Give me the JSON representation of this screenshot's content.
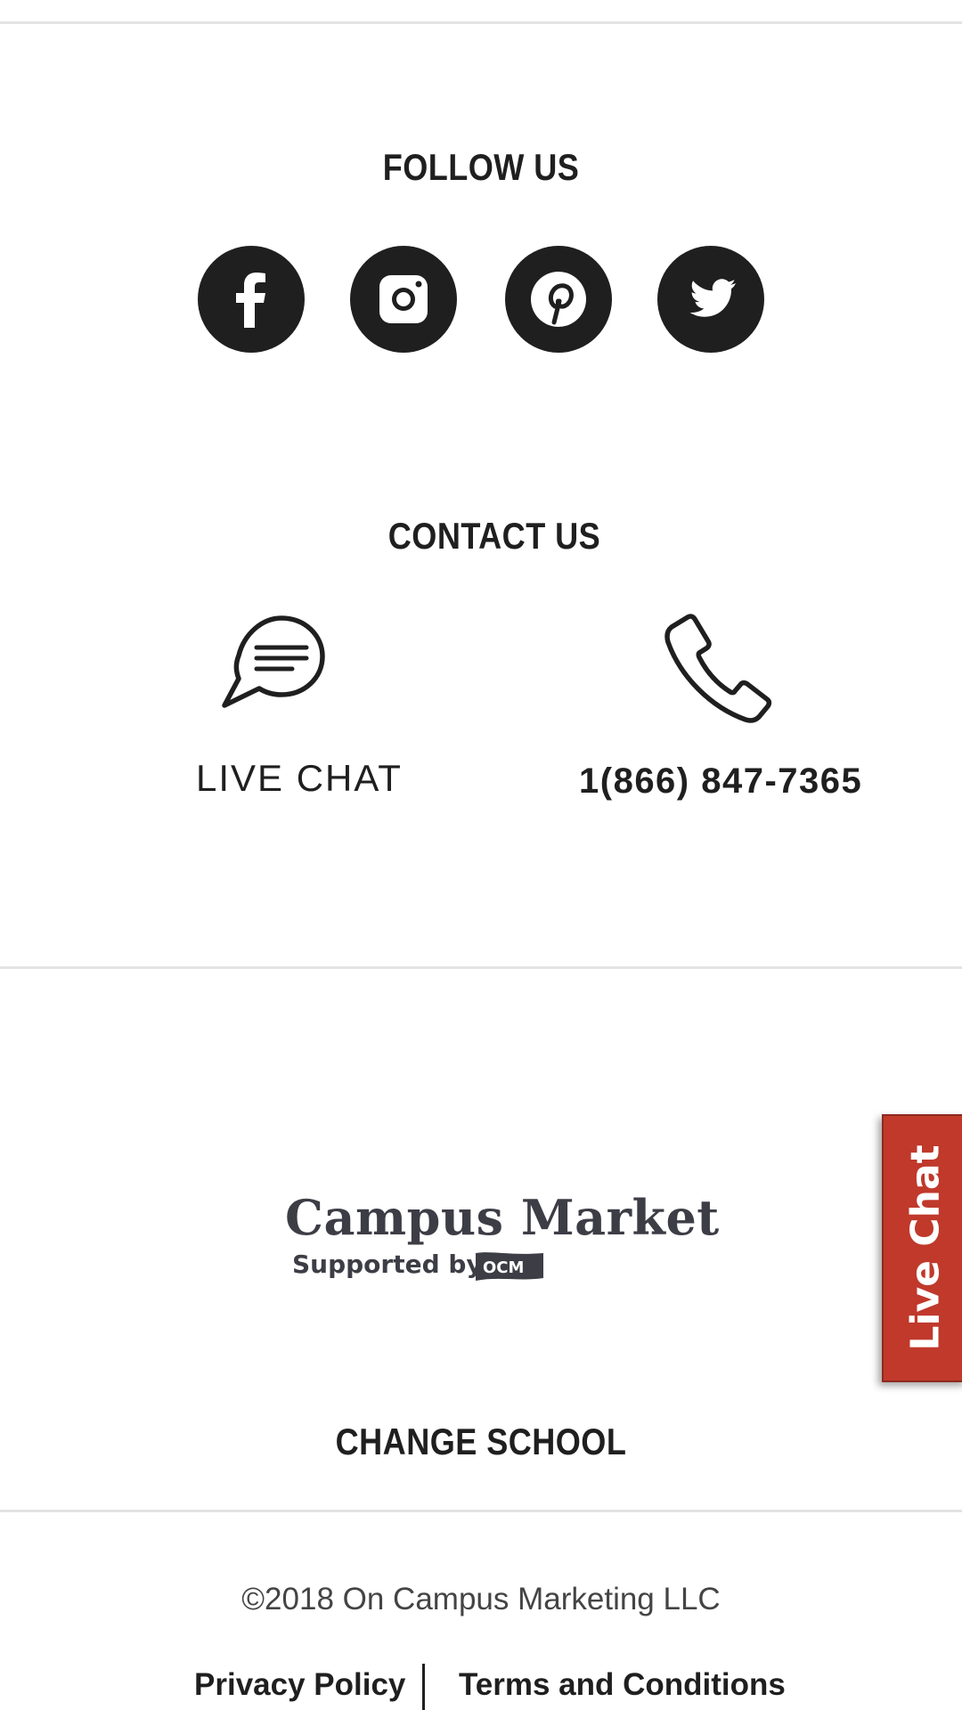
{
  "follow": {
    "heading": "FOLLOW US",
    "social": [
      {
        "name": "facebook-icon"
      },
      {
        "name": "instagram-icon"
      },
      {
        "name": "pinterest-icon"
      },
      {
        "name": "twitter-icon"
      }
    ]
  },
  "contact": {
    "heading": "CONTACT US",
    "chat_icon": "chat-bubble-icon",
    "chat_label": "LIVE CHAT",
    "phone_icon": "phone-icon",
    "phone_number": "1(866) 847-7365"
  },
  "logo": {
    "title": "Campus Market",
    "subtitle": "Supported by",
    "badge": "OCM"
  },
  "change_school": "CHANGE SCHOOL",
  "footer": {
    "copyright": "©2018 On Campus Marketing LLC",
    "privacy": "Privacy Policy",
    "terms": "Terms and Conditions"
  },
  "live_chat_tab": "Live Chat",
  "colors": {
    "text": "#1f1f1f",
    "icon_bg": "#1f1f1f",
    "accent_tab": "#c0392b",
    "divider": "#e3e3e3"
  }
}
